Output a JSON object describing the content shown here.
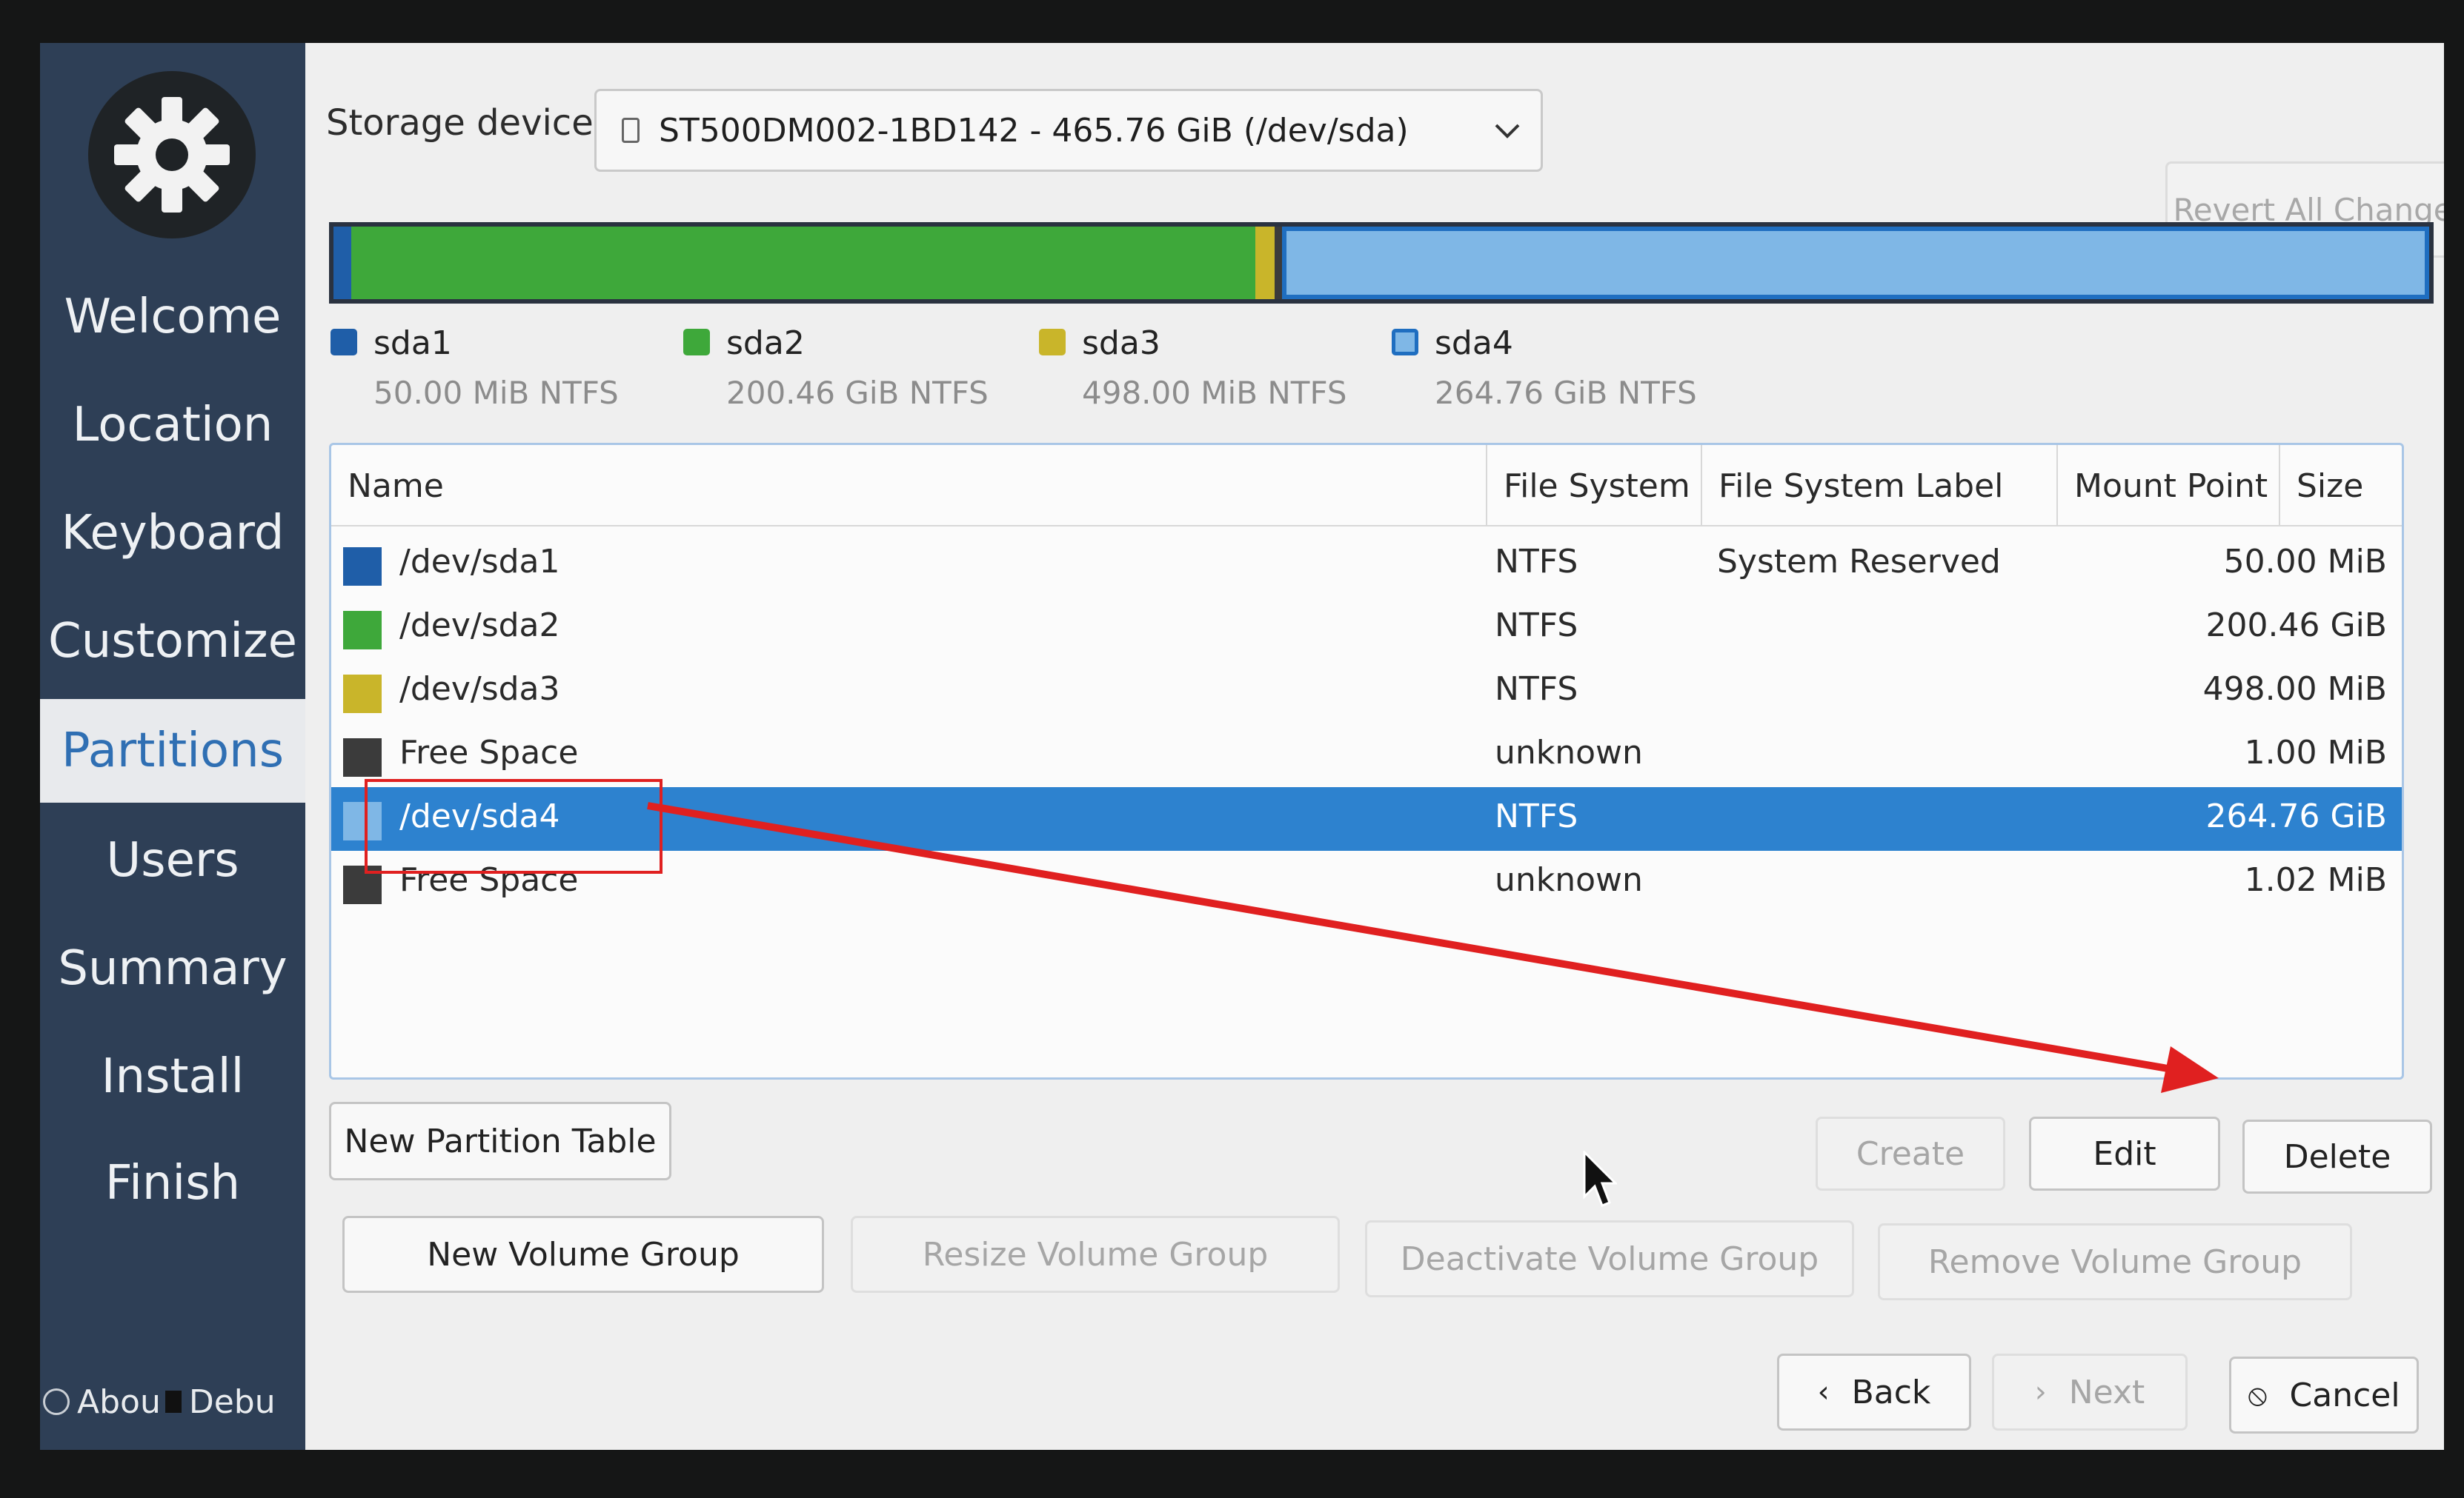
{
  "sidebar": {
    "items": [
      {
        "label": "Welcome"
      },
      {
        "label": "Location"
      },
      {
        "label": "Keyboard"
      },
      {
        "label": "Customize"
      },
      {
        "label": "Partitions",
        "active": true
      },
      {
        "label": "Users"
      },
      {
        "label": "Summary"
      },
      {
        "label": "Install"
      },
      {
        "label": "Finish"
      }
    ],
    "about_label": "Abou",
    "debug_label": "Debu"
  },
  "storage": {
    "label": "Storage device:",
    "device": "ST500DM002-1BD142 - 465.76 GiB (/dev/sda)"
  },
  "revert_label": "Revert All Changes",
  "legend": [
    {
      "name": "sda1",
      "info": "50.00 MiB  NTFS",
      "color": "#1f5ea8"
    },
    {
      "name": "sda2",
      "info": "200.46 GiB  NTFS",
      "color": "#3ea83a"
    },
    {
      "name": "sda3",
      "info": "498.00 MiB  NTFS",
      "color": "#c9b52a"
    },
    {
      "name": "sda4",
      "info": "264.76 GiB  NTFS",
      "color": "#7fb7e6"
    }
  ],
  "table": {
    "columns": [
      "Name",
      "File System",
      "File System Label",
      "Mount Point",
      "Size"
    ],
    "rows": [
      {
        "name": "/dev/sda1",
        "fs": "NTFS",
        "label": "System Reserved",
        "mount": "",
        "size": "50.00 MiB",
        "color": "#1f5ea8"
      },
      {
        "name": "/dev/sda2",
        "fs": "NTFS",
        "label": "",
        "mount": "",
        "size": "200.46 GiB",
        "color": "#3ea83a"
      },
      {
        "name": "/dev/sda3",
        "fs": "NTFS",
        "label": "",
        "mount": "",
        "size": "498.00 MiB",
        "color": "#c9b52a"
      },
      {
        "name": "Free Space",
        "fs": "unknown",
        "label": "",
        "mount": "",
        "size": "1.00 MiB",
        "color": "#3b3b3b"
      },
      {
        "name": "/dev/sda4",
        "fs": "NTFS",
        "label": "",
        "mount": "",
        "size": "264.76 GiB",
        "color": "#7fb7e6",
        "selected": true
      },
      {
        "name": "Free Space",
        "fs": "unknown",
        "label": "",
        "mount": "",
        "size": "1.02 MiB",
        "color": "#3b3b3b"
      }
    ]
  },
  "buttons": {
    "new_partition_table": "New Partition Table",
    "create": "Create",
    "edit": "Edit",
    "delete": "Delete",
    "new_volume_group": "New Volume Group",
    "resize_volume_group": "Resize Volume Group",
    "deactivate_volume_group": "Deactivate Volume Group",
    "remove_volume_group": "Remove Volume Group",
    "back": "Back",
    "next": "Next",
    "cancel": "Cancel"
  },
  "colors": {
    "sidebar_bg": "#2e3f56",
    "selection": "#2d82cf",
    "annotation": "#e02020"
  }
}
